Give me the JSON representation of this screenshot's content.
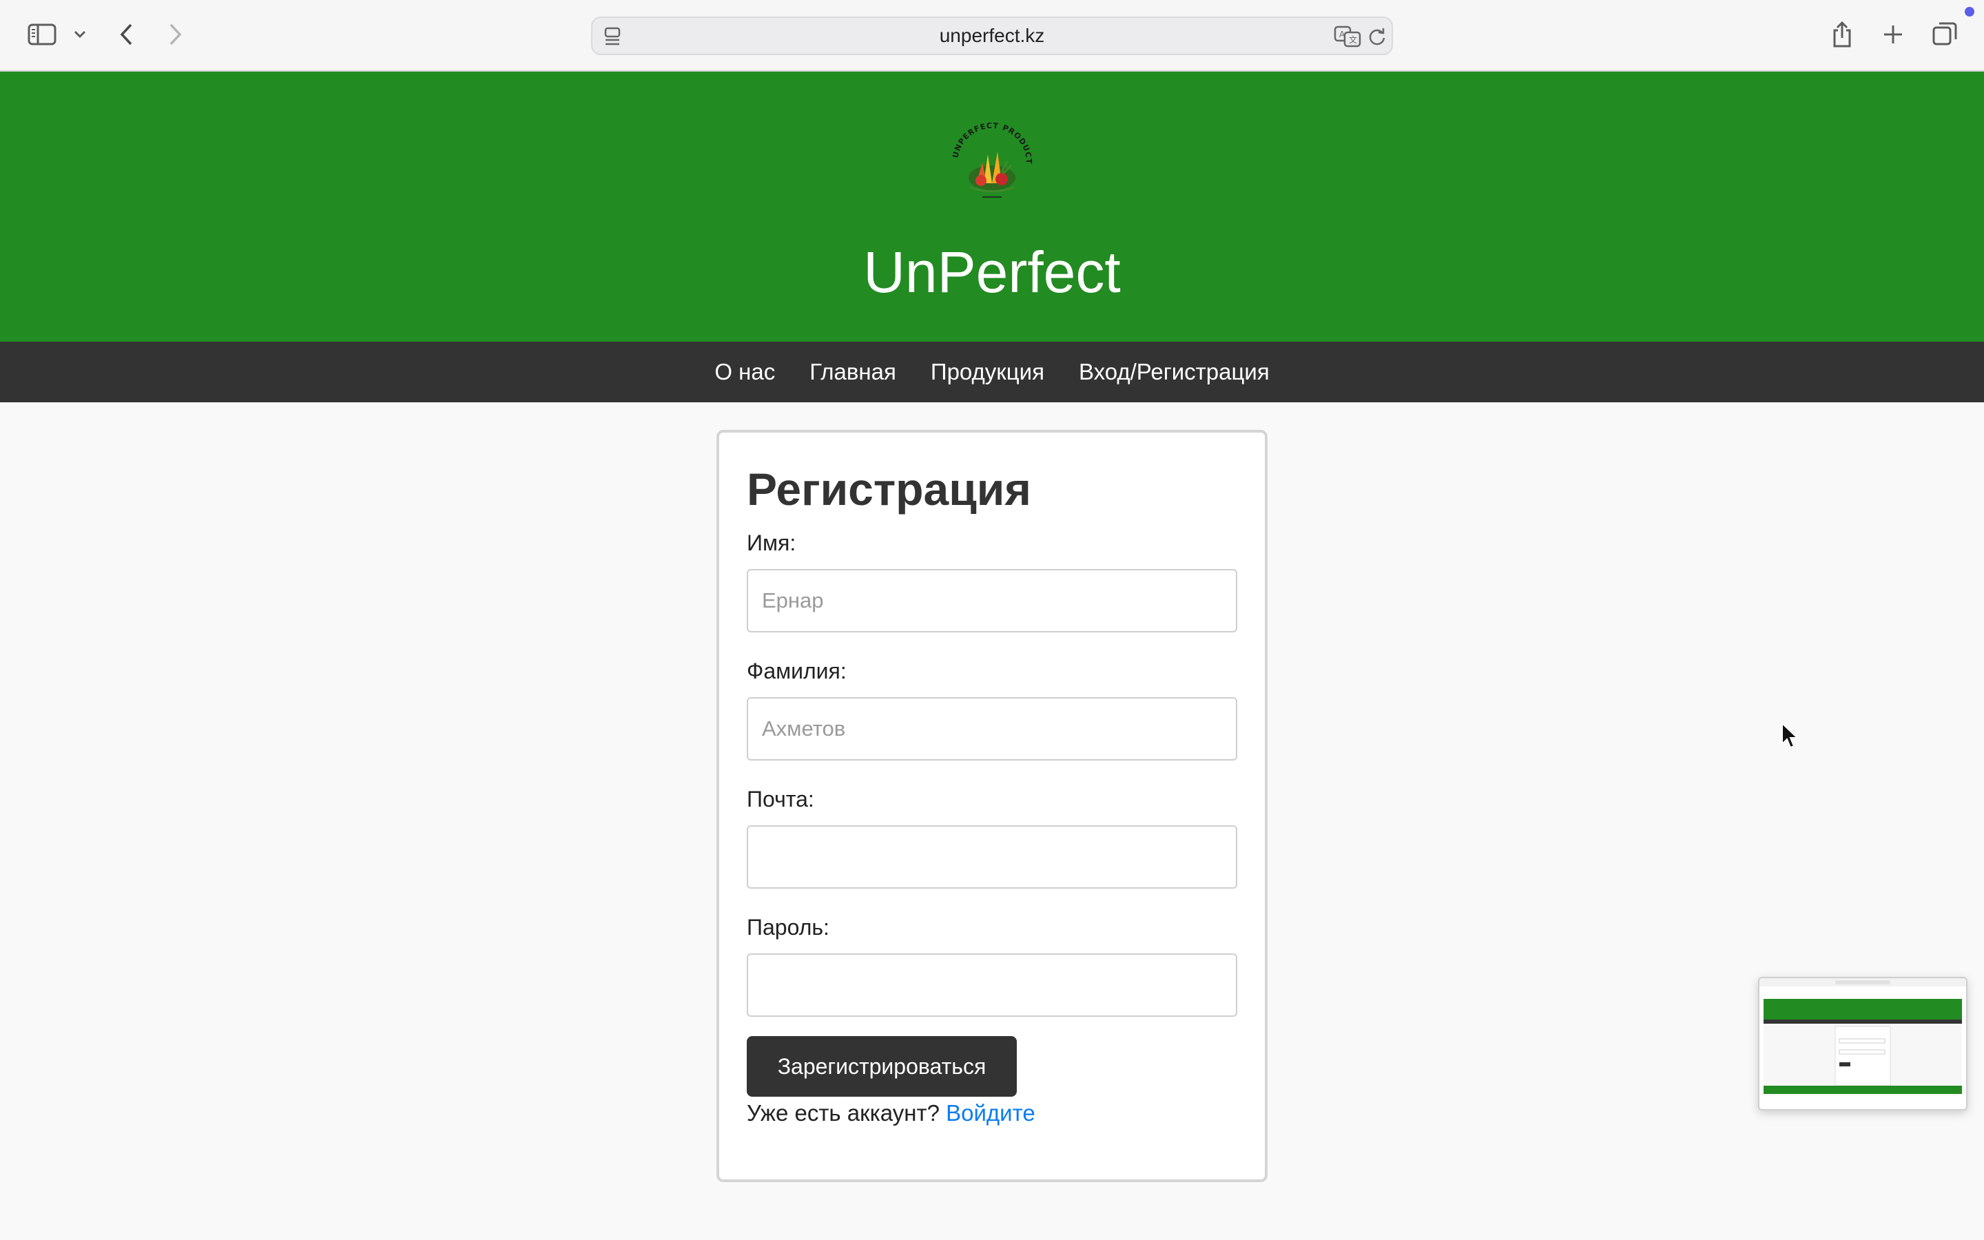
{
  "browser": {
    "url": "unperfect.kz"
  },
  "site": {
    "title": "UnPerfect",
    "logo_text": "UNPERFECT PRODUCTS",
    "brand_color": "#228b22",
    "nav_color": "#333333"
  },
  "nav": {
    "items": [
      {
        "label": "О нас"
      },
      {
        "label": "Главная"
      },
      {
        "label": "Продукция"
      },
      {
        "label": "Вход/Регистрация"
      }
    ]
  },
  "form": {
    "title": "Регистрация",
    "first_name": {
      "label": "Имя:",
      "placeholder": "Ернар",
      "value": ""
    },
    "last_name": {
      "label": "Фамилия:",
      "placeholder": "Ахметов",
      "value": ""
    },
    "email": {
      "label": "Почта:",
      "placeholder": "",
      "value": ""
    },
    "password": {
      "label": "Пароль:",
      "placeholder": "",
      "value": ""
    },
    "submit_label": "Зарегистрироваться",
    "login_prompt": "Уже есть аккаунт?",
    "login_link": "Войдите",
    "link_color": "#0a7cf2"
  }
}
